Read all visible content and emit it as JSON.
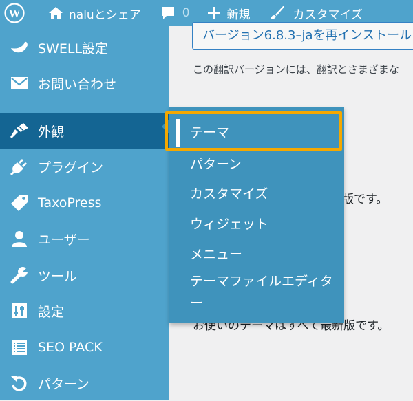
{
  "admin_bar": {
    "site_name": "naluとシェア",
    "comments_count": "0",
    "new_label": "新規",
    "customize_label": "カスタマイズ"
  },
  "content": {
    "reinstall_button": "バージョン6.8.3–jaを再インストール",
    "translation_note": "この翻訳バージョンには、翻訳とさまざまな",
    "themes_partial": "版です。",
    "themes_uptodate": "お使いのテーマはすべて最新版です。"
  },
  "sidebar": {
    "items": [
      {
        "label": "SWELL設定",
        "icon": "swell-icon"
      },
      {
        "label": "お問い合わせ",
        "icon": "mail-icon"
      },
      {
        "label": "外観",
        "icon": "brush-icon",
        "active": true
      },
      {
        "label": "プラグイン",
        "icon": "plugin-icon"
      },
      {
        "label": "TaxoPress",
        "icon": "tag-icon"
      },
      {
        "label": "ユーザー",
        "icon": "user-icon"
      },
      {
        "label": "ツール",
        "icon": "wrench-icon"
      },
      {
        "label": "設定",
        "icon": "settings-icon"
      },
      {
        "label": "SEO PACK",
        "icon": "list-icon"
      },
      {
        "label": "パターン",
        "icon": "undo-icon"
      }
    ]
  },
  "flyout": {
    "items": [
      "テーマ",
      "パターン",
      "カスタマイズ",
      "ウィジェット",
      "メニュー",
      "テーマファイルエディター"
    ],
    "current": "テーマ"
  },
  "colors": {
    "admin_bar": "#4fa3cc",
    "sidebar": "#4fa3cc",
    "active_item": "#146593",
    "flyout": "#3f93bc",
    "highlight": "#f5a800"
  }
}
